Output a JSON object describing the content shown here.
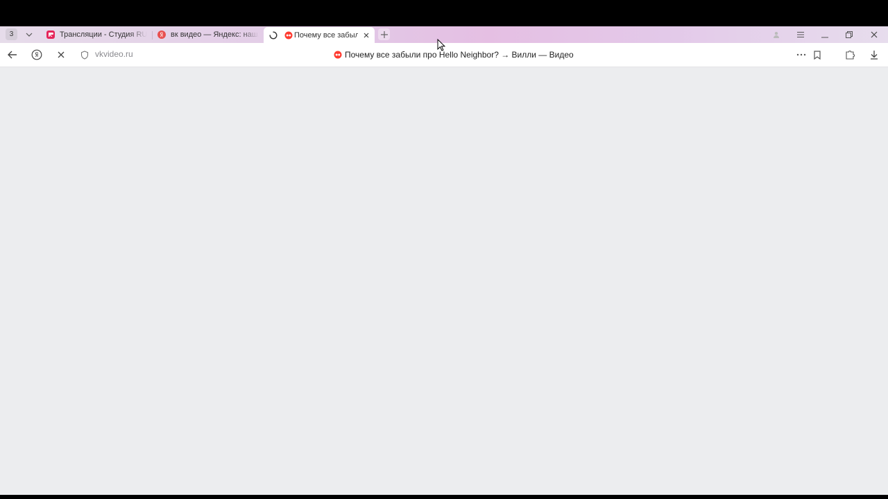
{
  "browser": {
    "tab_count": "3",
    "tabs": [
      {
        "label": "Трансляции - Студия RUTUBE",
        "icon": "rutube-favicon",
        "active": false
      },
      {
        "label": "вк видео — Яндекс: нашлось",
        "icon": "yandex-favicon",
        "active": false
      },
      {
        "label": "Почему все забыли про Hello Neighbor? → Вилли — Видео",
        "icon": "vk-video-favicon",
        "active": true
      }
    ]
  },
  "address_bar": {
    "domain": "vkvideo.ru",
    "page_title": "Почему все забыли про Hello Neighbor? → Вилли — Видео"
  },
  "colors": {
    "tabstrip": "#e2c8e6",
    "content_bg": "#ecedef",
    "rutube_red": "#e5255a",
    "yandex_red": "#e85050",
    "vk_red": "#ff3b30"
  }
}
